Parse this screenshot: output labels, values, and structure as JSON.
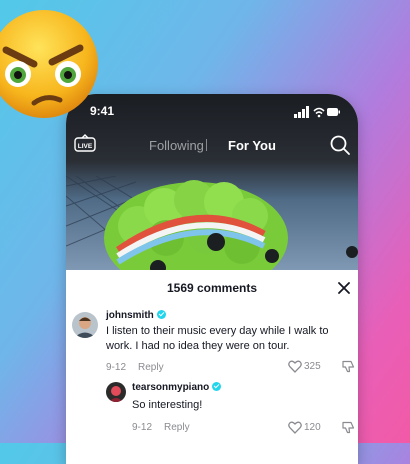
{
  "status_bar": {
    "time": "9:41"
  },
  "top_nav": {
    "live_label": "LIVE",
    "tab_following": "Following",
    "tab_for_you": "For You"
  },
  "comments": {
    "count_label": "1569 comments",
    "items": [
      {
        "username": "johnsmith",
        "text_line1": "I listen to their music every day while I walk to",
        "text_line2": "work. I had no idea they were on tour.",
        "date": "9-12",
        "reply_label": "Reply",
        "likes": "325"
      },
      {
        "username": "tearsonmypiano",
        "text_line1": "So interesting!",
        "date": "9-12",
        "reply_label": "Reply",
        "likes": "120"
      }
    ]
  },
  "icons": {
    "emoji": "angry-face-emoji",
    "search": "search-icon",
    "close": "close-icon",
    "like": "heart-icon",
    "dislike": "thumbs-down-icon",
    "verified": "verified-badge-icon"
  },
  "colors": {
    "verified": "#20d5ec",
    "text": "#161823",
    "muted": "#8a8b91"
  }
}
